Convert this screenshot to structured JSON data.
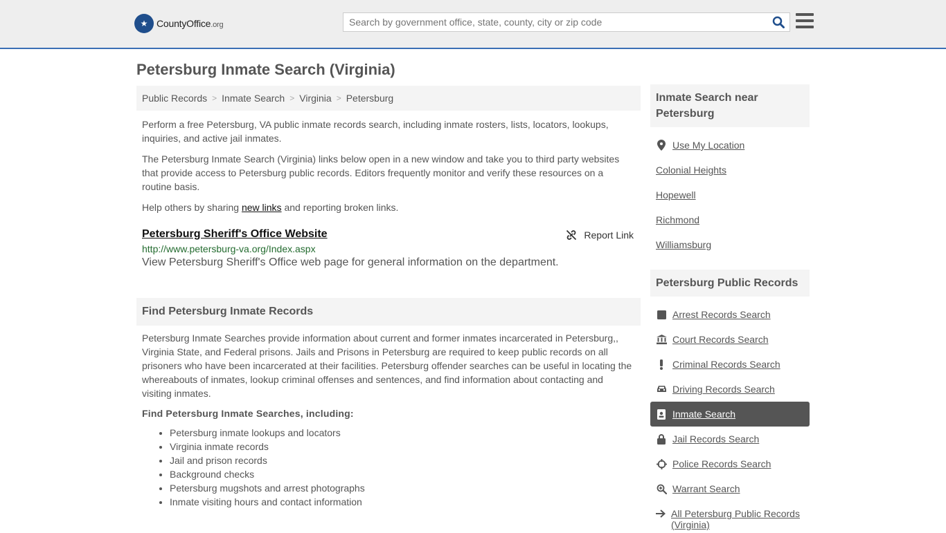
{
  "header": {
    "logo_main": "CountyOffice",
    "logo_tld": ".org",
    "search_placeholder": "Search by government office, state, county, city or zip code"
  },
  "page_title": "Petersburg Inmate Search (Virginia)",
  "breadcrumb": [
    "Public Records",
    "Inmate Search",
    "Virginia",
    "Petersburg"
  ],
  "intro": {
    "p1": "Perform a free Petersburg, VA public inmate records search, including inmate rosters, lists, locators, lookups, inquiries, and active jail inmates.",
    "p2": "The Petersburg Inmate Search (Virginia) links below open in a new window and take you to third party websites that provide access to Petersburg public records. Editors frequently monitor and verify these resources on a routine basis.",
    "p3_before": "Help others by sharing ",
    "p3_link": "new links",
    "p3_after": " and reporting broken links."
  },
  "link_card": {
    "title": "Petersburg Sheriff's Office Website",
    "report_label": "Report Link",
    "url": "http://www.petersburg-va.org/Index.aspx",
    "description": "View Petersburg Sheriff's Office web page for general information on the department."
  },
  "find_section": {
    "heading": "Find Petersburg Inmate Records",
    "body": "Petersburg Inmate Searches provide information about current and former inmates incarcerated in Petersburg,, Virginia State, and Federal prisons. Jails and Prisons in Petersburg are required to keep public records on all prisoners who have been incarcerated at their facilities. Petersburg offender searches can be useful in locating the whereabouts of inmates, lookup criminal offenses and sentences, and find information about contacting and visiting inmates.",
    "subheading": "Find Petersburg Inmate Searches, including:",
    "items": [
      "Petersburg inmate lookups and locators",
      "Virginia inmate records",
      "Jail and prison records",
      "Background checks",
      "Petersburg mugshots and arrest photographs",
      "Inmate visiting hours and contact information"
    ]
  },
  "sidebar": {
    "near_heading": "Inmate Search near Petersburg",
    "use_location": "Use My Location",
    "near_items": [
      "Colonial Heights",
      "Hopewell",
      "Richmond",
      "Williamsburg"
    ],
    "records_heading": "Petersburg Public Records",
    "records_items": [
      {
        "label": "Arrest Records Search",
        "icon": "square-icon"
      },
      {
        "label": "Court Records Search",
        "icon": "courthouse-icon"
      },
      {
        "label": "Criminal Records Search",
        "icon": "exclamation-icon"
      },
      {
        "label": "Driving Records Search",
        "icon": "car-icon"
      },
      {
        "label": "Inmate Search",
        "icon": "id-badge-icon",
        "active": true
      },
      {
        "label": "Jail Records Search",
        "icon": "lock-icon"
      },
      {
        "label": "Police Records Search",
        "icon": "crosshairs-icon"
      },
      {
        "label": "Warrant Search",
        "icon": "zoom-in-icon"
      },
      {
        "label": "All Petersburg Public Records (Virginia)",
        "icon": "arrow-right-icon"
      }
    ]
  },
  "colors": {
    "accent_border": "#3a6fb5",
    "active_bg": "#555555",
    "url_green": "#236b2f"
  }
}
